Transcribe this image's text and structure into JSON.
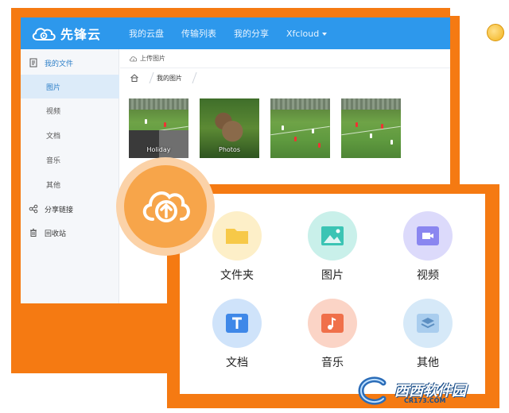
{
  "app": {
    "logo_text": "先锋云",
    "nav": [
      {
        "label": "我的云盘"
      },
      {
        "label": "传输列表"
      },
      {
        "label": "我的分享"
      },
      {
        "label": "Xfcloud"
      }
    ]
  },
  "sidebar": {
    "items": [
      {
        "label": "我的文件",
        "icon": "file-icon"
      },
      {
        "label": "图片"
      },
      {
        "label": "视频"
      },
      {
        "label": "文档"
      },
      {
        "label": "音乐"
      },
      {
        "label": "其他"
      },
      {
        "label": "分享链接",
        "icon": "share-icon"
      },
      {
        "label": "回收站",
        "icon": "trash-icon"
      }
    ]
  },
  "toolbar": {
    "upload_label": "上传图片"
  },
  "breadcrumb": {
    "current": "我的图片"
  },
  "thumbnails": [
    {
      "label": "Holiday"
    },
    {
      "label": "Photos"
    },
    {
      "label": ""
    },
    {
      "label": ""
    }
  ],
  "picker": {
    "types": [
      {
        "label": "文件夹",
        "color": "#f7c948",
        "bg": "#fdefc8",
        "icon": "folder-icon"
      },
      {
        "label": "图片",
        "color": "#3bc4b4",
        "bg": "#c9f0ea",
        "icon": "image-icon"
      },
      {
        "label": "视频",
        "color": "#8a86f0",
        "bg": "#dcdafb",
        "icon": "video-icon"
      },
      {
        "label": "文档",
        "color": "#3f88e8",
        "bg": "#cfe3fa",
        "icon": "text-icon"
      },
      {
        "label": "音乐",
        "color": "#f0704a",
        "bg": "#fbd4c6",
        "icon": "music-icon"
      },
      {
        "label": "其他",
        "color": "#6fa8dc",
        "bg": "#d6e9f8",
        "icon": "layers-icon"
      }
    ]
  },
  "colors": {
    "accent": "#2d98ec",
    "promo_orange": "#f57a12",
    "upload_orange": "#f7a54a"
  },
  "watermark": {
    "text": "西西软件园",
    "sub": "CR173.COM"
  }
}
